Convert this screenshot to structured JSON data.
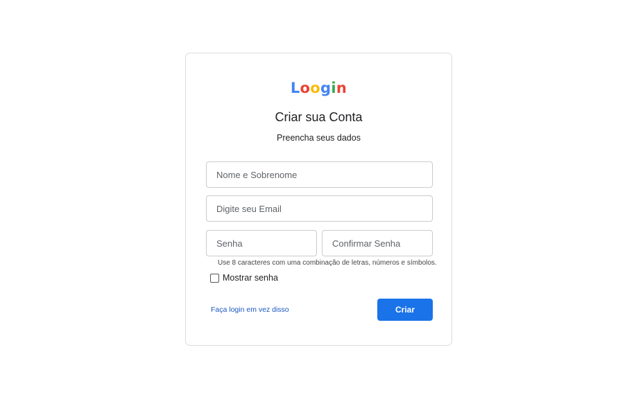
{
  "logo": {
    "letters": [
      "L",
      "o",
      "o",
      "g",
      "i",
      "n"
    ],
    "colors": [
      "#4285f4",
      "#ea4335",
      "#fbbc05",
      "#4285f4",
      "#34a853",
      "#ea4335"
    ]
  },
  "form": {
    "title": "Criar sua Conta",
    "subtitle": "Preencha seus dados",
    "name_placeholder": "Nome e Sobrenome",
    "email_placeholder": "Digite seu Email",
    "password_placeholder": "Senha",
    "confirm_placeholder": "Confirmar Senha",
    "password_hint": "Use 8 caracteres com uma combinação de letras, números e símbolos.",
    "show_password_label": "Mostrar senha",
    "login_link": "Faça login em vez disso",
    "create_button": "Criar"
  },
  "colors": {
    "primary": "#1a73e8",
    "link": "#1a56c4",
    "border": "#dadce0"
  }
}
